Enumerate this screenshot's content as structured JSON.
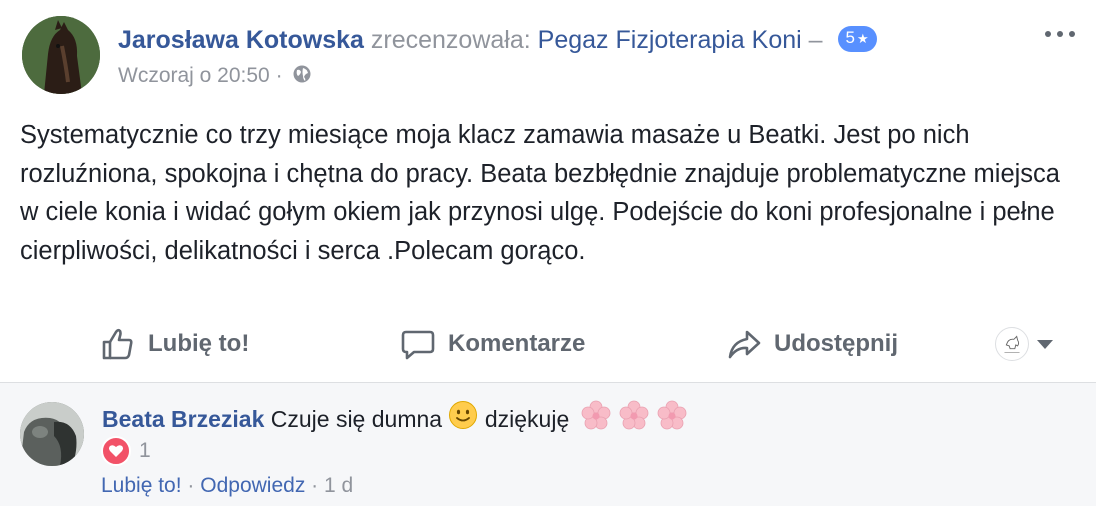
{
  "post": {
    "author": "Jarosława Kotowska",
    "action_text": "zrecenzowała:",
    "page_name": "Pegaz Fizjoterapia Koni",
    "dash": "–",
    "rating": "5",
    "rating_star": "★",
    "timestamp": "Wczoraj o 20:50",
    "separator": "·",
    "audience_icon": "globe-icon",
    "text": "Systematycznie co trzy miesiące moja klacz zamawia masaże u Beatki. Jest po nich rozluźniona, spokojna i chętna do pracy. Beata bezbłędnie znajduje problematyczne miejsca w ciele konia i widać gołym okiem jak przynosi ulgę. Podejście do koni profesjonalne i pełne cierpliwości, delikatności i serca .Polecam gorąco."
  },
  "actions": {
    "like": "Lubię to!",
    "comment": "Komentarze",
    "share": "Udostępnij"
  },
  "comment": {
    "author": "Beata Brzeziak",
    "text_before": "Czuje się dumna",
    "text_after": "dziękuję",
    "emoji_smile": "slightly-smiling-face",
    "emoji_flowers": [
      "cherry-blossom",
      "cherry-blossom",
      "cherry-blossom"
    ],
    "reaction_count": "1",
    "reaction_icon": "heart-icon",
    "like_link": "Lubię to!",
    "separator": "·",
    "reply_link": "Odpowiedz",
    "age": "1 d"
  },
  "colors": {
    "link_blue": "#365899",
    "muted_gray": "#90949c",
    "badge_blue": "#5890ff",
    "heart_red": "#f25268",
    "comment_bg": "#f6f7f9"
  }
}
